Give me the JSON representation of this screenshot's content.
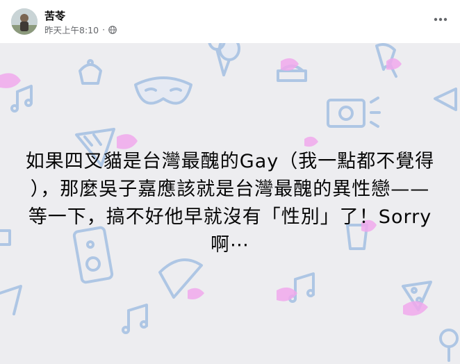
{
  "post": {
    "author": "苦苓",
    "timestamp": "昨天上午8:10",
    "separator": "·",
    "privacy_icon": "globe-icon",
    "more_icon": "more-horizontal-icon",
    "body_text": "如果四叉貓是台灣最醜的Gay（我一點都不覺得￼），那麼吳子嘉應該就是￼台灣最醜的異性戀——等一下，￼搞不好他早就沒有「性別」了！￼￼Sorry啊⋯"
  },
  "colors": {
    "background": "#ededf0",
    "pattern_blue": "#aec6e4",
    "pattern_pink": "#f0a8ec"
  }
}
